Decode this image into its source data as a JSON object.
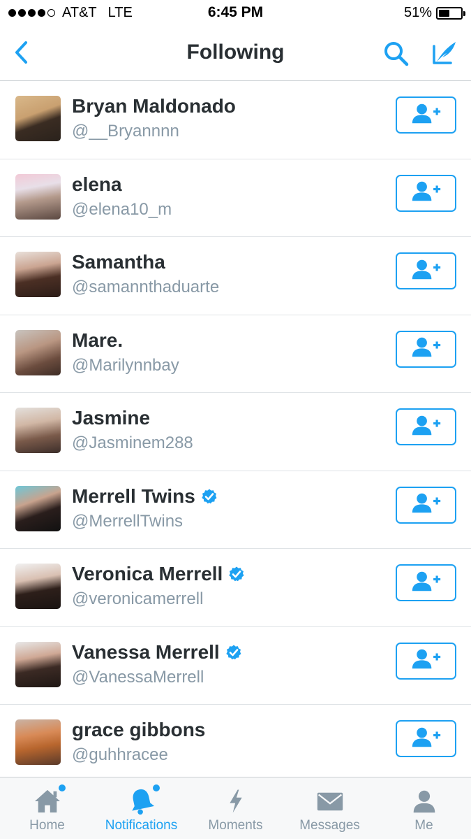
{
  "status_bar": {
    "carrier": "AT&T",
    "network": "LTE",
    "time": "6:45 PM",
    "battery": "51%",
    "battery_level": 0.51,
    "signal_bars_filled": 4,
    "signal_bars_total": 5
  },
  "nav": {
    "title": "Following",
    "back_icon": "chevron-left-icon",
    "search_icon": "search-icon",
    "compose_icon": "compose-icon"
  },
  "colors": {
    "accent": "#1da1f2",
    "text": "#292f33",
    "muted": "#8899a6",
    "verified": "#1da1f2"
  },
  "users": [
    {
      "name": "Bryan Maldonado",
      "handle": "@__Bryannnn",
      "verified": false
    },
    {
      "name": "elena",
      "handle": "@elena10_m",
      "verified": false
    },
    {
      "name": "Samantha",
      "handle": "@samannthaduarte",
      "verified": false
    },
    {
      "name": "Mare.",
      "handle": "@Marilynnbay",
      "verified": false
    },
    {
      "name": "Jasmine",
      "handle": "@Jasminem288",
      "verified": false
    },
    {
      "name": "Merrell Twins",
      "handle": "@MerrellTwins",
      "verified": true
    },
    {
      "name": "Veronica Merrell",
      "handle": "@veronicamerrell",
      "verified": true
    },
    {
      "name": "Vanessa Merrell",
      "handle": "@VanessaMerrell",
      "verified": true
    },
    {
      "name": "grace gibbons",
      "handle": "@guhhracee",
      "verified": false
    }
  ],
  "tabs": [
    {
      "label": "Home",
      "icon": "home-icon",
      "active": false,
      "dot": true
    },
    {
      "label": "Notifications",
      "icon": "bell-icon",
      "active": true,
      "dot": true
    },
    {
      "label": "Moments",
      "icon": "lightning-icon",
      "active": false,
      "dot": false
    },
    {
      "label": "Messages",
      "icon": "envelope-icon",
      "active": false,
      "dot": false
    },
    {
      "label": "Me",
      "icon": "person-icon",
      "active": false,
      "dot": false
    }
  ]
}
